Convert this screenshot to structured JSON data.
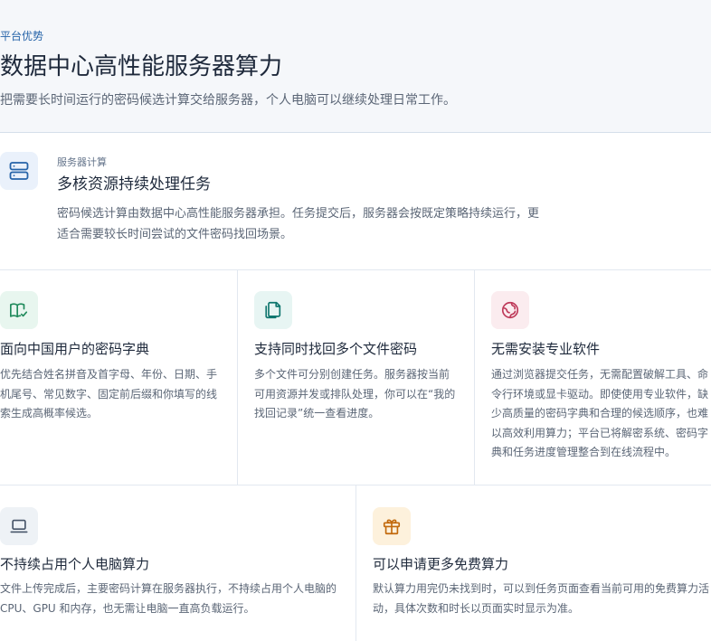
{
  "hero": {
    "eyebrow": "平台优势",
    "title": "数据中心高性能服务器算力",
    "description": "把需要长时间运行的密码候选计算交给服务器，个人电脑可以继续处理日常工作。"
  },
  "feature": {
    "icon": "server-icon",
    "eyebrow": "服务器计算",
    "title": "多核资源持续处理任务",
    "description": "密码候选计算由数据中心高性能服务器承担。任务提交后，服务器会按既定策略持续运行，更适合需要较长时间尝试的文件密码找回场景。"
  },
  "cards_row1": [
    {
      "icon": "book-check-icon",
      "title": "面向中国用户的密码字典",
      "description": "优先结合姓名拼音及首字母、年份、日期、手机尾号、常见数字、固定前后缀和你填写的线索生成高概率候选。"
    },
    {
      "icon": "copy-files-icon",
      "title": "支持同时找回多个文件密码",
      "description": "多个文件可分别创建任务。服务器按当前可用资源并发或排队处理，你可以在“我的找回记录”统一查看进度。"
    },
    {
      "icon": "globe-icon",
      "title": "无需安装专业软件",
      "description": "通过浏览器提交任务，无需配置破解工具、命令行环境或显卡驱动。即使使用专业软件，缺少高质量的密码字典和合理的候选顺序，也难以高效利用算力；平台已将解密系统、密码字典和任务进度管理整合到在线流程中。"
    }
  ],
  "cards_row2": [
    {
      "icon": "laptop-icon",
      "title": "不持续占用个人电脑算力",
      "description": "文件上传完成后，主要密码计算在服务器执行，不持续占用个人电脑的 CPU、GPU 和内存，也无需让电脑一直高负载运行。"
    },
    {
      "icon": "gift-icon",
      "title": "可以申请更多免费算力",
      "description": "默认算力用完仍未找到时，可以到任务页面查看当前可用的免费算力活动，具体次数和时长以页面实时显示为准。"
    }
  ],
  "colors": {
    "accent_blue": "#2563a8",
    "green_icon": "#1f8a5b",
    "teal_icon": "#0f766e",
    "rose_icon": "#be3a5a",
    "slate_icon": "#475569",
    "amber_icon": "#c2690c"
  }
}
